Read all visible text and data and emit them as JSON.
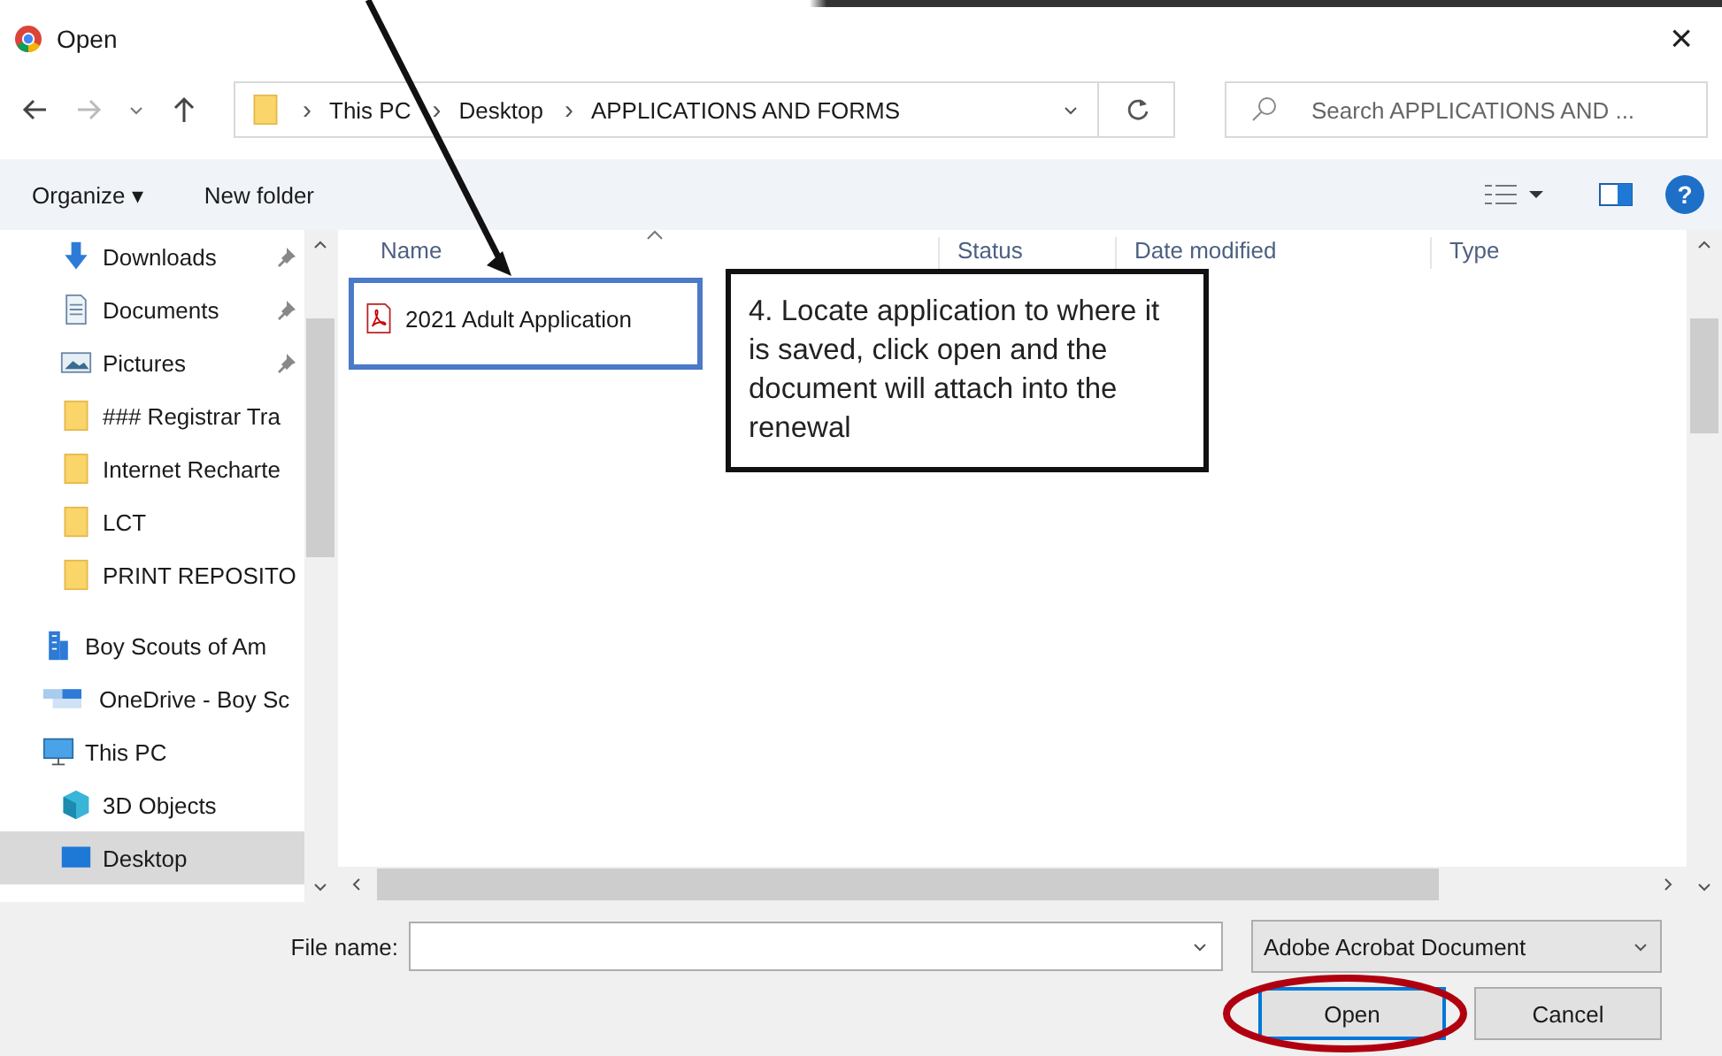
{
  "window": {
    "title": "Open",
    "close": "×"
  },
  "address": {
    "path": [
      {
        "label": "This PC"
      },
      {
        "label": "Desktop"
      },
      {
        "label": "APPLICATIONS AND FORMS"
      }
    ],
    "separator": "›"
  },
  "search": {
    "placeholder": "Search APPLICATIONS AND ..."
  },
  "toolbar": {
    "organize": "Organize ▾",
    "new_folder": "New folder",
    "help": "?"
  },
  "sidebar": {
    "quick_access": [
      {
        "label": "Downloads",
        "kind": "download",
        "pinned": true,
        "selected": false
      },
      {
        "label": "Documents",
        "kind": "documents",
        "pinned": true,
        "selected": false
      },
      {
        "label": "Pictures",
        "kind": "pictures",
        "pinned": true,
        "selected": false
      },
      {
        "label": "### Registrar Tra",
        "kind": "folder",
        "pinned": false,
        "selected": false
      },
      {
        "label": "Internet Recharte",
        "kind": "folder",
        "pinned": false,
        "selected": false
      },
      {
        "label": "LCT",
        "kind": "folder",
        "pinned": false,
        "selected": false
      },
      {
        "label": "PRINT REPOSITO",
        "kind": "folder",
        "pinned": false,
        "selected": false
      }
    ],
    "locations": [
      {
        "label": "Boy Scouts of Am",
        "kind": "building",
        "selected": false
      },
      {
        "label": "OneDrive - Boy Sc",
        "kind": "cloud",
        "selected": false
      },
      {
        "label": "This PC",
        "kind": "pc",
        "selected": false,
        "children": [
          {
            "label": "3D Objects",
            "kind": "cube",
            "selected": false
          },
          {
            "label": "Desktop",
            "kind": "desktop",
            "selected": true
          }
        ]
      }
    ]
  },
  "table": {
    "columns": [
      "Name",
      "Status",
      "Date modified",
      "Type"
    ],
    "rows": [
      {
        "name": "2021 Adult Application",
        "kind": "pdf"
      }
    ]
  },
  "callout": {
    "text": "4. Locate application to where it is saved, click open and the document will attach into the renewal"
  },
  "file_name": {
    "label": "File name:"
  },
  "file_type": {
    "value": "Adobe Acrobat Document"
  },
  "buttons": [
    {
      "label": "Open",
      "kind": "primary"
    },
    {
      "label": "Cancel",
      "kind": "secondary"
    }
  ]
}
